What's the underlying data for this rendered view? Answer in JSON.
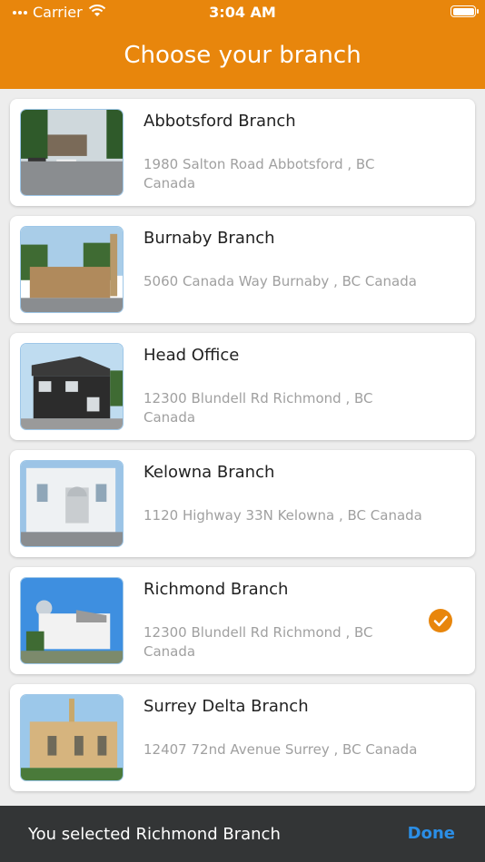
{
  "status_bar": {
    "carrier": "Carrier",
    "time": "3:04 AM",
    "icons": [
      "signal-dots-icon",
      "wifi-icon",
      "battery-icon"
    ]
  },
  "header": {
    "title": "Choose your branch",
    "color": "#e8860c"
  },
  "branches": [
    {
      "name": "Abbotsford Branch",
      "address": "1980 Salton Road Abbotsford , BC Canada",
      "selected": false
    },
    {
      "name": "Burnaby Branch",
      "address": "5060 Canada Way Burnaby , BC Canada",
      "selected": false
    },
    {
      "name": "Head Office",
      "address": "12300 Blundell Rd Richmond , BC Canada",
      "selected": false
    },
    {
      "name": "Kelowna Branch",
      "address": "1120 Highway 33N Kelowna , BC Canada",
      "selected": false
    },
    {
      "name": "Richmond Branch",
      "address": "12300 Blundell Rd Richmond , BC Canada",
      "selected": true
    },
    {
      "name": "Surrey Delta Branch",
      "address": "12407 72nd Avenue Surrey , BC Canada",
      "selected": false
    }
  ],
  "footer": {
    "selection_text": "You selected Richmond Branch",
    "done_label": "Done",
    "done_color": "#2b8ee6"
  }
}
